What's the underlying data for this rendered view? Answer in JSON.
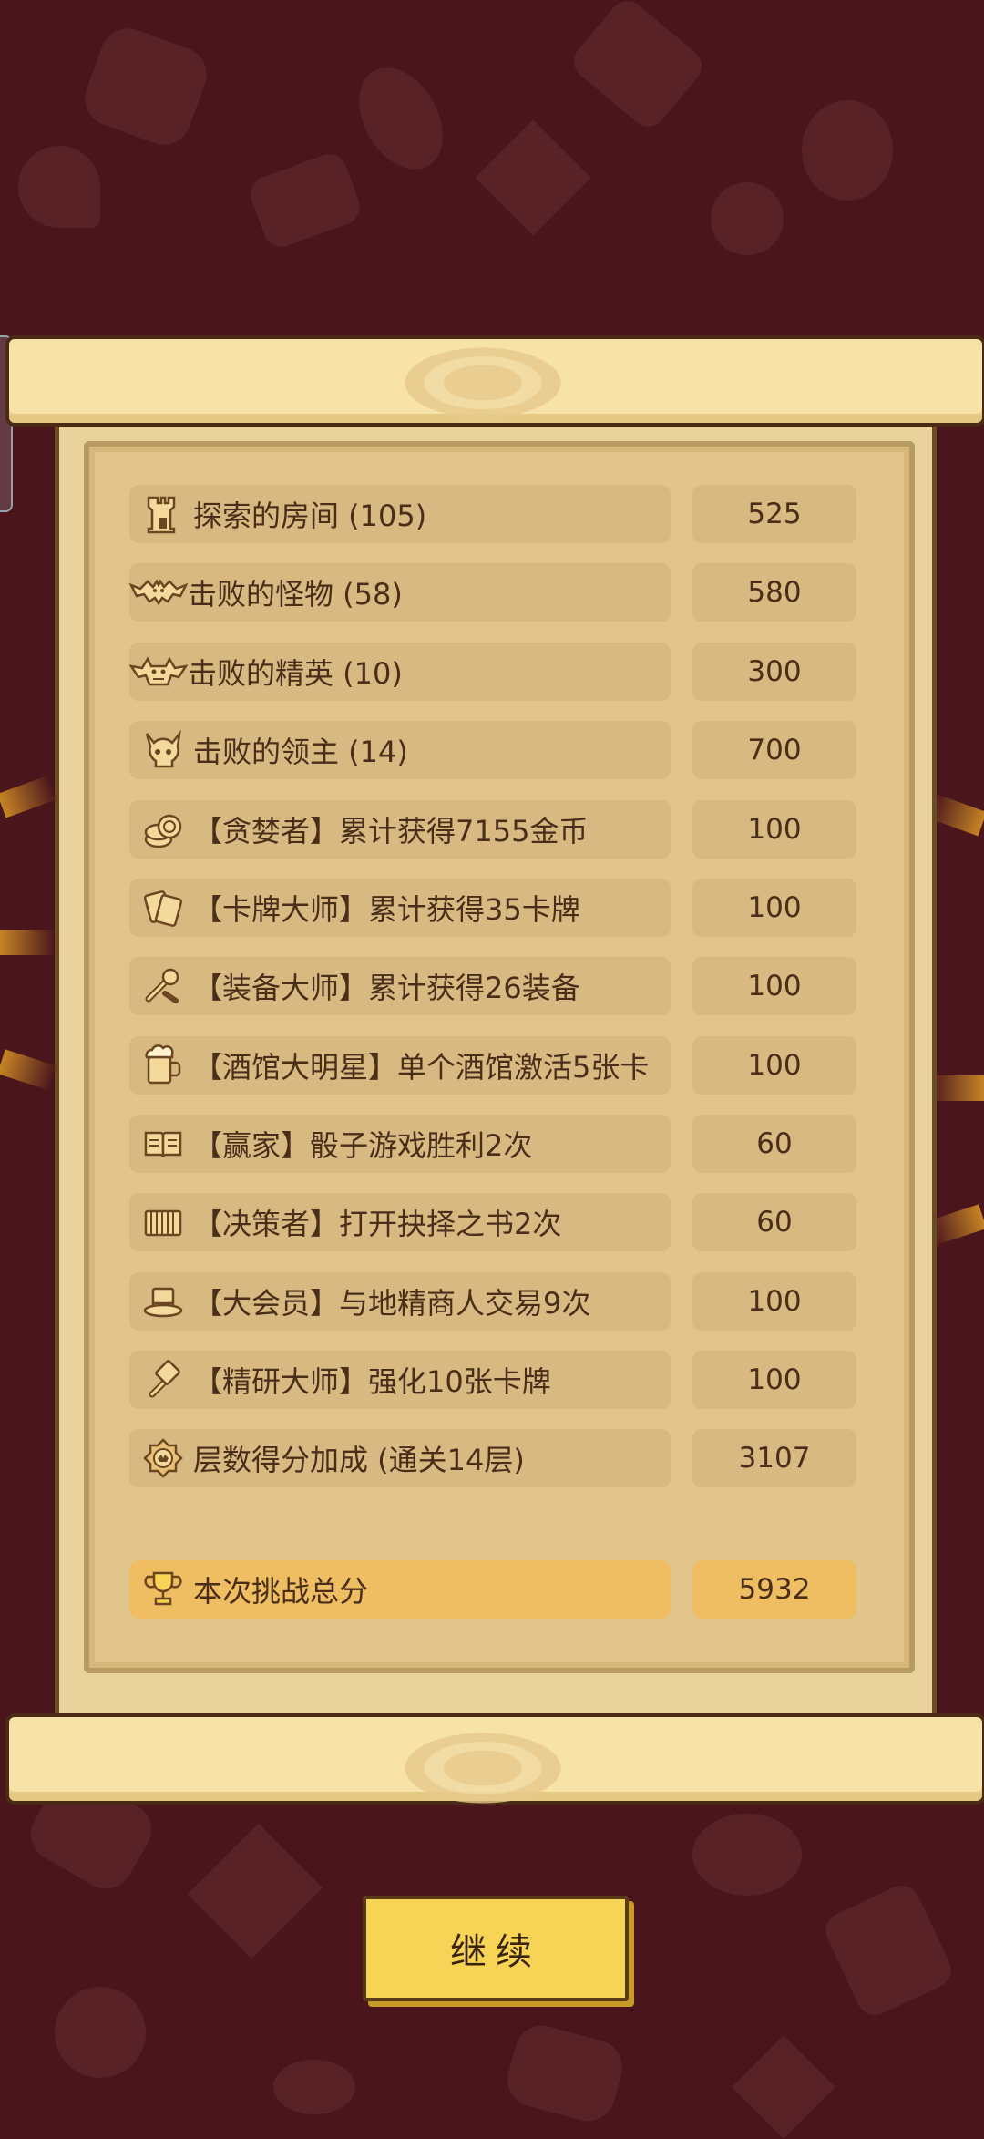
{
  "rows": [
    {
      "icon": "tower-icon",
      "label": "探索的房间 (105)",
      "value": "525"
    },
    {
      "icon": "bat-icon",
      "label": "击败的怪物 (58)",
      "value": "580"
    },
    {
      "icon": "winged-demon-icon",
      "label": "击败的精英 (10)",
      "value": "300"
    },
    {
      "icon": "horned-skull-icon",
      "label": "击败的领主 (14)",
      "value": "700"
    },
    {
      "icon": "coins-icon",
      "label": "【贪婪者】累计获得7155金币",
      "value": "100"
    },
    {
      "icon": "cards-icon",
      "label": "【卡牌大师】累计获得35卡牌",
      "value": "100"
    },
    {
      "icon": "equipment-icon",
      "label": "【装备大师】累计获得26装备",
      "value": "100"
    },
    {
      "icon": "beer-mug-icon",
      "label": "【酒馆大明星】单个酒馆激活5张卡",
      "value": "100"
    },
    {
      "icon": "open-book-icon",
      "label": "【赢家】骰子游戏胜利2次",
      "value": "60"
    },
    {
      "icon": "book-icon",
      "label": "【决策者】打开抉择之书2次",
      "value": "60"
    },
    {
      "icon": "top-hat-icon",
      "label": "【大会员】与地精商人交易9次",
      "value": "100"
    },
    {
      "icon": "hammer-icon",
      "label": "【精研大师】强化10张卡牌",
      "value": "100"
    },
    {
      "icon": "crest-badge-icon",
      "label": "层数得分加成 (通关14层)",
      "value": "3107"
    }
  ],
  "total": {
    "icon": "trophy-icon",
    "label": "本次挑战总分",
    "value": "5932"
  },
  "continue_label": "继续",
  "colors": {
    "background": "#4a161c",
    "paper": "#e9d29b",
    "row": "#d7b981",
    "total_row": "#efbd62",
    "button": "#f7d455"
  }
}
